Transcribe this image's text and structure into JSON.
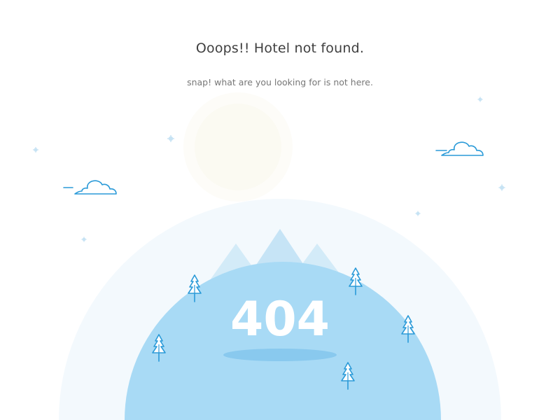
{
  "header": {
    "title": "Ooops!! Hotel not found.",
    "subtitle": "snap! what are you looking for is not here."
  },
  "illustration": {
    "error_code": "404",
    "icons": [
      "cloud-icon",
      "snowflake-icon",
      "pine-tree-icon",
      "mountain-icon",
      "moon-icon"
    ]
  },
  "colors": {
    "outer_glow": "#f3f9fd",
    "globe": "#a8daf5",
    "mountain": "#cde8f7",
    "shadow": "#89c9ee",
    "line": "#2a9ad8",
    "snow": "#c7e3f4",
    "text": "#3f3f3f",
    "muted_text": "#777777"
  }
}
